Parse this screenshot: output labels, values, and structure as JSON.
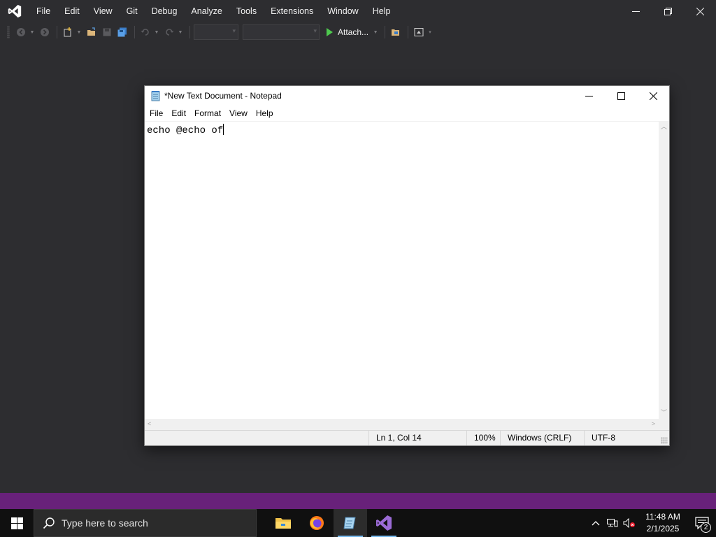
{
  "vs": {
    "menu": [
      "File",
      "Edit",
      "View",
      "Git",
      "Debug",
      "Analyze",
      "Tools",
      "Extensions",
      "Window",
      "Help"
    ],
    "toolbar": {
      "attach_label": "Attach..."
    },
    "accent_color": "#68217a"
  },
  "notepad": {
    "title": "*New Text Document - Notepad",
    "menu": [
      "File",
      "Edit",
      "Format",
      "View",
      "Help"
    ],
    "content": "echo @echo of",
    "status": {
      "position": "Ln 1, Col 14",
      "zoom": "100%",
      "line_endings": "Windows (CRLF)",
      "encoding": "UTF-8"
    }
  },
  "taskbar": {
    "search_placeholder": "Type here to search",
    "pinned": [
      "file-explorer-icon",
      "firefox-icon",
      "notepad-icon",
      "visual-studio-icon"
    ],
    "clock_time": "11:48 AM",
    "clock_date": "2/1/2025",
    "notification_count": "2"
  }
}
